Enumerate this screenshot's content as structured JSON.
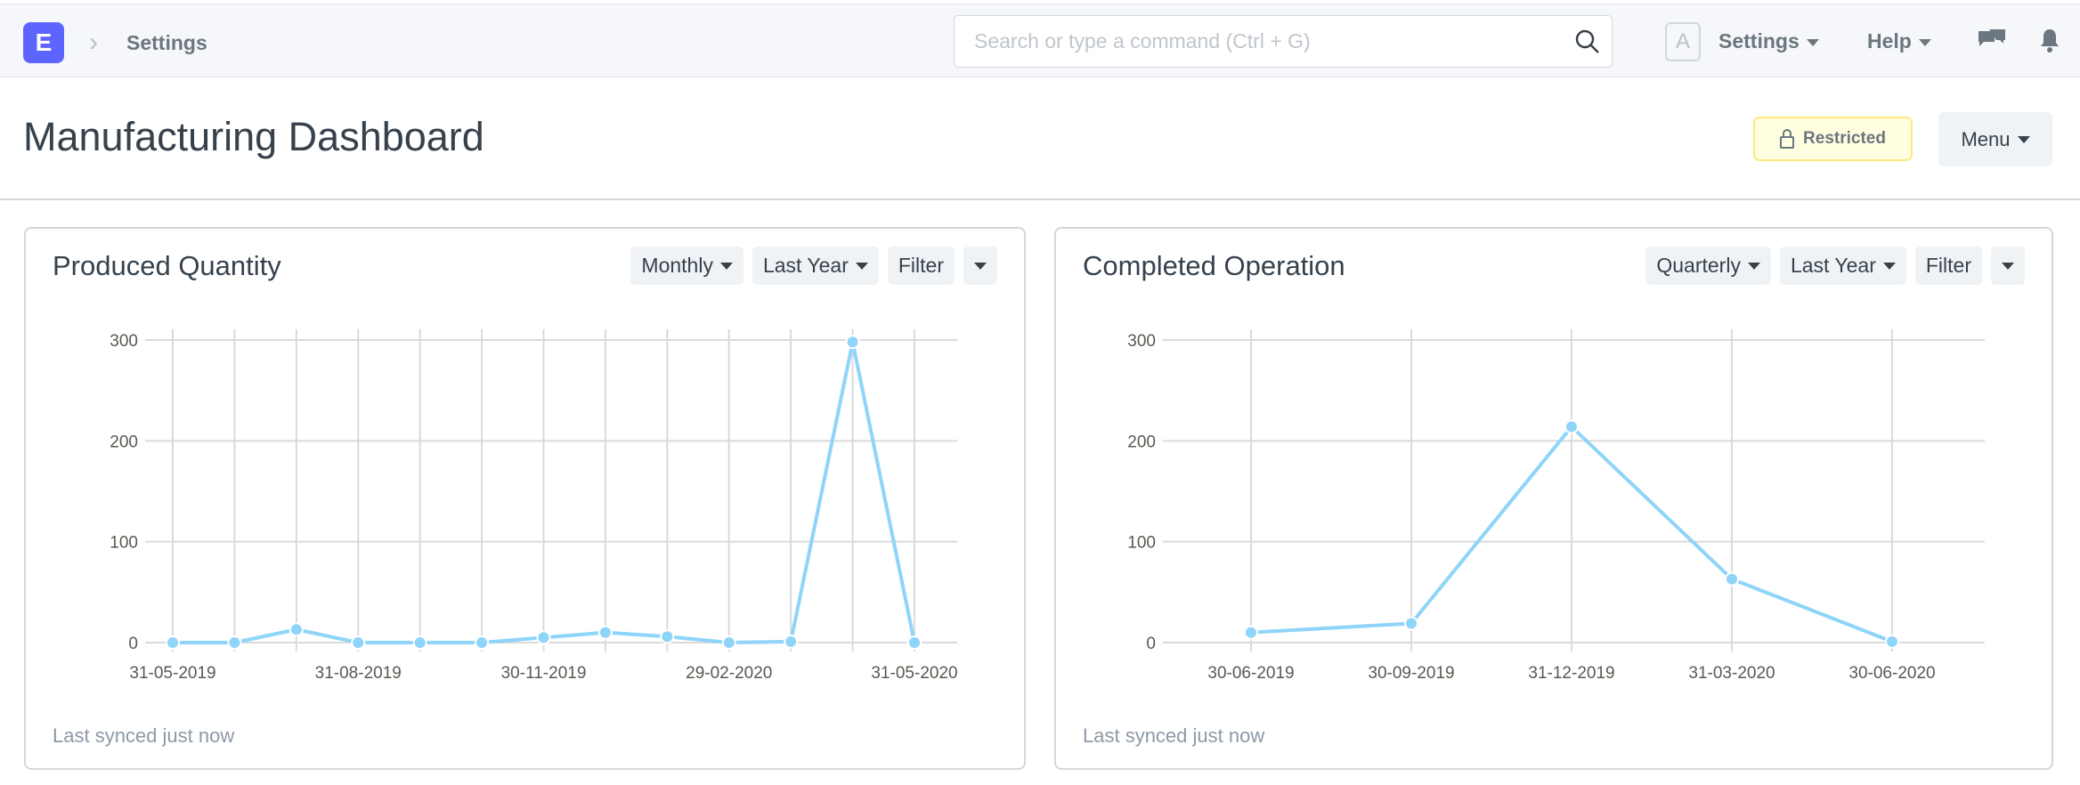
{
  "navbar": {
    "logo": "E",
    "breadcrumb": "Settings",
    "search_placeholder": "Search or type a command (Ctrl + G)",
    "avatar": "A",
    "settings": "Settings",
    "help": "Help"
  },
  "page": {
    "title": "Manufacturing Dashboard",
    "restricted": "Restricted",
    "menu": "Menu"
  },
  "colors": {
    "line": "#8fd4f9",
    "accent": "#5e64ff"
  },
  "cards": [
    {
      "title": "Produced Quantity",
      "controls": [
        "Monthly",
        "Last Year",
        "Filter"
      ],
      "synced": "Last synced just now"
    },
    {
      "title": "Completed Operation",
      "controls": [
        "Quarterly",
        "Last Year",
        "Filter"
      ],
      "synced": "Last synced just now"
    }
  ],
  "chart_data": [
    {
      "type": "line",
      "title": "Produced Quantity",
      "ylim": [
        0,
        300
      ],
      "yticks": [
        0,
        100,
        200,
        300
      ],
      "grid": true,
      "x": [
        "31-05-2019",
        "30-06-2019",
        "31-07-2019",
        "31-08-2019",
        "30-09-2019",
        "31-10-2019",
        "30-11-2019",
        "31-12-2019",
        "31-01-2020",
        "29-02-2020",
        "31-03-2020",
        "30-04-2020",
        "31-05-2020"
      ],
      "xtick_labels": [
        "31-05-2019",
        "",
        "",
        "31-08-2019",
        "",
        "",
        "30-11-2019",
        "",
        "",
        "29-02-2020",
        "",
        "",
        "31-05-2020"
      ],
      "values": [
        0,
        0,
        13,
        0,
        0,
        0,
        5,
        10,
        6,
        0,
        1,
        298,
        0
      ]
    },
    {
      "type": "line",
      "title": "Completed Operation",
      "ylim": [
        0,
        300
      ],
      "yticks": [
        0,
        100,
        200,
        300
      ],
      "grid": true,
      "x": [
        "30-06-2019",
        "30-09-2019",
        "31-12-2019",
        "31-03-2020",
        "30-06-2020"
      ],
      "xtick_labels": [
        "30-06-2019",
        "30-09-2019",
        "31-12-2019",
        "31-03-2020",
        "30-06-2020"
      ],
      "values": [
        10,
        19,
        214,
        63,
        1
      ]
    }
  ]
}
